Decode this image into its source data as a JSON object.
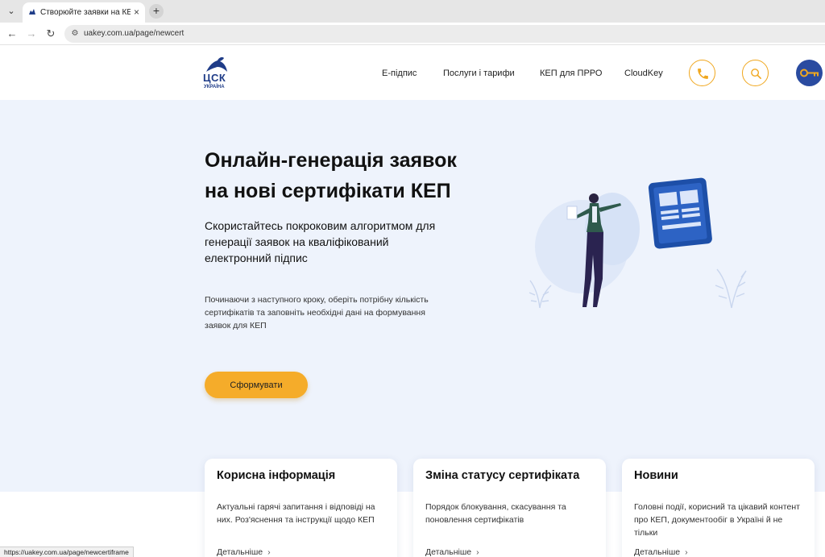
{
  "browser": {
    "tab_title": "Створюйте заявки на КЕП онлайн",
    "tab_close": "×",
    "new_tab": "+",
    "url": "uakey.com.ua/page/newcert",
    "status_url": "https://uakey.com.ua/page/newcertiframe"
  },
  "header": {
    "logo_text": "ЦСК",
    "logo_sub": "УКРАЇНА",
    "nav": [
      "Е-підпис",
      "Послуги і тарифи",
      "КЕП для ПРРО",
      "CloudKey"
    ]
  },
  "hero": {
    "title_line1": "Онлайн-генерація заявок",
    "title_line2": "на нові сертифікати КЕП",
    "lead": "Скористайтесь покроковим алгоритмом для генерації заявок на кваліфікований електронний підпис",
    "note": "Починаючи з наступного кроку, оберіть потрібну кількість сертифікатів та заповніть необхідні дані на формування заявок для КЕП",
    "cta": "Сформувати"
  },
  "cards": [
    {
      "title": "Корисна інформація",
      "text": "Актуальні гарячі запитання і відповіді на них. Роз'яснення та інструкції щодо КЕП",
      "link": "Детальніше"
    },
    {
      "title": "Зміна статусу сертифіката",
      "text": "Порядок блокування, скасування та поновлення сертифікатів",
      "link": "Детальніше"
    },
    {
      "title": "Новини",
      "text": "Головні події, корисний та цікавий контент про КЕП, документообіг в Україні й не тільки",
      "link": "Детальніше"
    }
  ],
  "icons": {
    "phone": "phone-icon",
    "search": "search-icon",
    "key": "key-icon"
  },
  "colors": {
    "accent": "#f5ac2a",
    "brand": "#1f3c88",
    "hero_bg": "#eef3fc"
  }
}
